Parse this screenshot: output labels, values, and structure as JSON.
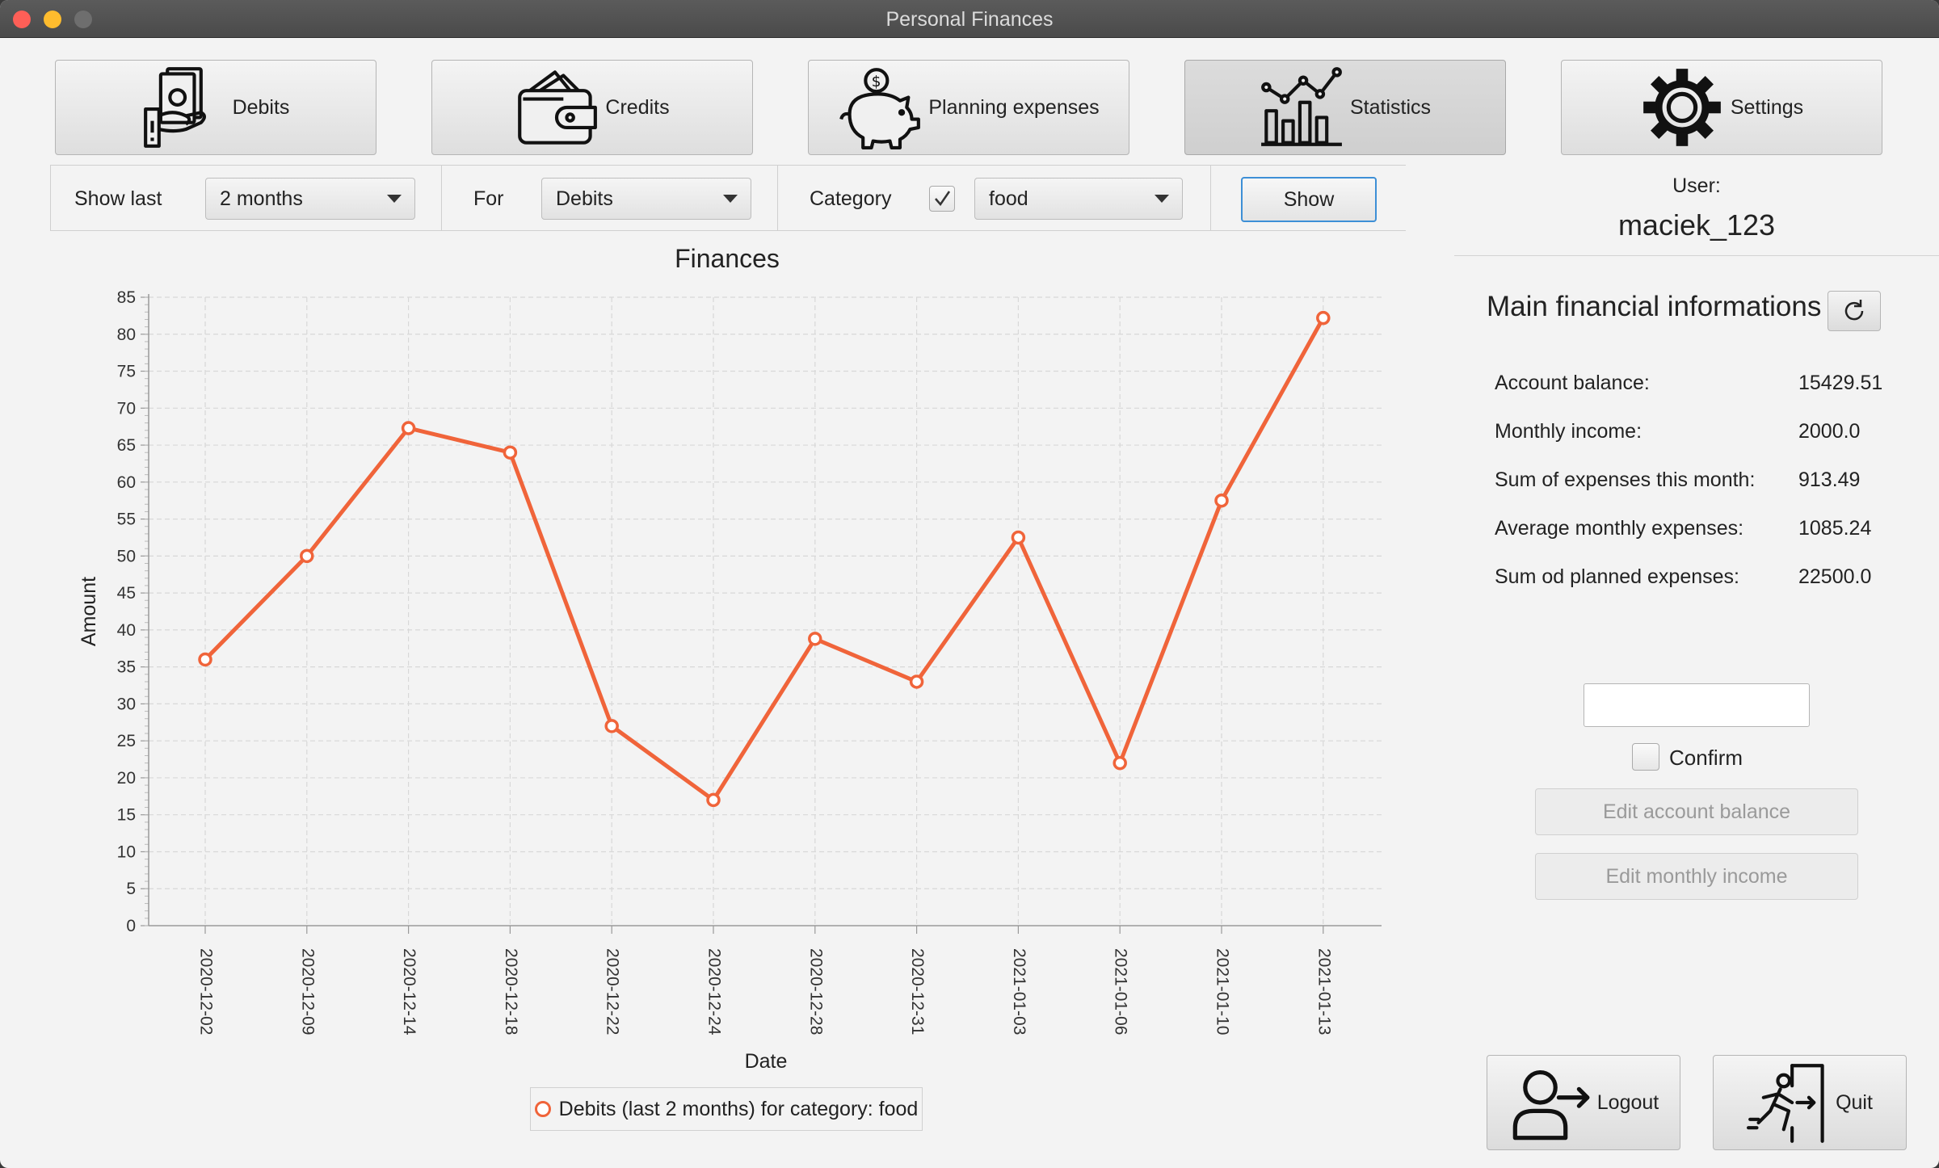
{
  "window": {
    "title": "Personal Finances"
  },
  "nav": {
    "debits": {
      "label": "Debits",
      "icon": "cash-hand-icon"
    },
    "credits": {
      "label": "Credits",
      "icon": "wallet-icon"
    },
    "planning": {
      "label": "Planning expenses",
      "icon": "piggy-bank-icon"
    },
    "statistics": {
      "label": "Statistics",
      "icon": "bar-chart-icon",
      "active": true
    },
    "settings": {
      "label": "Settings",
      "icon": "gear-icon"
    }
  },
  "filters": {
    "show_last_label": "Show last",
    "show_last_value": "2 months",
    "for_label": "For",
    "for_value": "Debits",
    "category_label": "Category",
    "category_checked": true,
    "category_value": "food",
    "show_button": "Show"
  },
  "user": {
    "label": "User:",
    "name": "maciek_123"
  },
  "info": {
    "title": "Main financial informations",
    "rows": [
      {
        "label": "Account balance:",
        "value": "15429.51"
      },
      {
        "label": "Monthly income:",
        "value": "2000.0"
      },
      {
        "label": "Sum of expenses this month:",
        "value": "913.49"
      },
      {
        "label": "Average monthly expenses:",
        "value": "1085.24"
      },
      {
        "label": "Sum od planned expenses:",
        "value": "22500.0"
      }
    ]
  },
  "edit": {
    "input_value": "",
    "confirm_label": "Confirm",
    "edit_balance": "Edit account balance",
    "edit_income": "Edit monthly income"
  },
  "bottom": {
    "logout": "Logout",
    "quit": "Quit"
  },
  "colors": {
    "series": "#f0643a",
    "focus": "#3d8fd6"
  },
  "chart_data": {
    "type": "line",
    "title": "Finances",
    "xlabel": "Date",
    "ylabel": "Amount",
    "ylim": [
      0,
      85
    ],
    "yticks": [
      0,
      5,
      10,
      15,
      20,
      25,
      30,
      35,
      40,
      45,
      50,
      55,
      60,
      65,
      70,
      75,
      80,
      85
    ],
    "grid": true,
    "legend_position": "bottom",
    "x": [
      "2020-12-02",
      "2020-12-09",
      "2020-12-14",
      "2020-12-18",
      "2020-12-22",
      "2020-12-24",
      "2020-12-28",
      "2020-12-31",
      "2021-01-03",
      "2021-01-06",
      "2021-01-10",
      "2021-01-13"
    ],
    "series": [
      {
        "name": "Debits (last 2 months) for category: food",
        "values": [
          36,
          50,
          67.3,
          64,
          27,
          17,
          38.8,
          33,
          52.5,
          22,
          57.5,
          82.2
        ]
      }
    ]
  }
}
